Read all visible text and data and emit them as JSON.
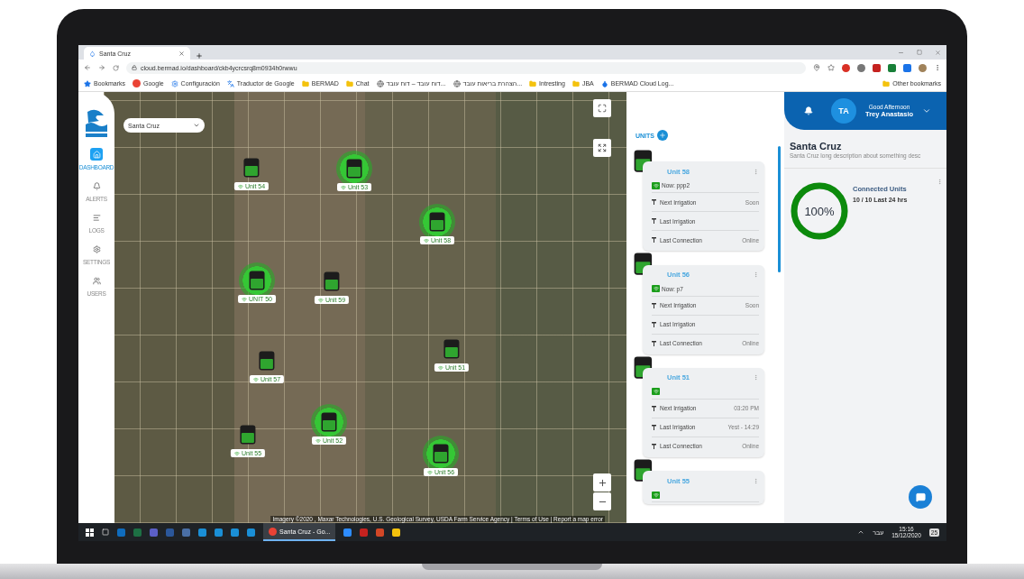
{
  "browser": {
    "tab_title": "Santa Cruz",
    "url": "cloud.bermad.io/dashboard/ckb4ycrcsrq8m0934h0rwwu",
    "bookmarks": [
      {
        "label": "Bookmarks",
        "kind": "star"
      },
      {
        "label": "Google",
        "kind": "google"
      },
      {
        "label": "Configuración",
        "kind": "gear"
      },
      {
        "label": "Traductor de Google",
        "kind": "translate"
      },
      {
        "label": "BERMAD",
        "kind": "folder"
      },
      {
        "label": "Chat",
        "kind": "folder"
      },
      {
        "label": "דוח עובד – דוח עובד...",
        "kind": "globe"
      },
      {
        "label": "הצהרת בריאות עובד...",
        "kind": "globe"
      },
      {
        "label": "Intresting",
        "kind": "folder"
      },
      {
        "label": "JBA",
        "kind": "folder"
      },
      {
        "label": "BERMAD Cloud Log...",
        "kind": "logo"
      }
    ],
    "other_bookmarks": "Other bookmarks"
  },
  "nav": {
    "items": [
      {
        "label": "DASHBOARD",
        "kind": "home",
        "selected": true
      },
      {
        "label": "ALERTS",
        "kind": "bell",
        "selected": false
      },
      {
        "label": "LOGS",
        "kind": "lines",
        "selected": false
      },
      {
        "label": "SETTINGS",
        "kind": "gear",
        "selected": false
      },
      {
        "label": "USERS",
        "kind": "users",
        "selected": false
      }
    ]
  },
  "map": {
    "site_select": "Santa Cruz",
    "markers": [
      {
        "label": "Unit 54",
        "highlighted": false
      },
      {
        "label": "Unit 53",
        "highlighted": true
      },
      {
        "label": "Unit 58",
        "highlighted": true
      },
      {
        "label": "UNIT 50",
        "highlighted": true
      },
      {
        "label": "Unit 59",
        "highlighted": false
      },
      {
        "label": "Unit 51",
        "highlighted": false
      },
      {
        "label": "Unit 57",
        "highlighted": false
      },
      {
        "label": "Unit 52",
        "highlighted": true
      },
      {
        "label": "Unit 55",
        "highlighted": false
      },
      {
        "label": "Unit 56",
        "highlighted": true
      }
    ],
    "attribution": "Imagery ©2020 , Maxar Technologies, U.S. Geological Survey, USDA Farm Service Agency | Terms of Use | Report a map error"
  },
  "units": {
    "title": "UNITS",
    "cards": [
      {
        "name": "Unit 58",
        "status": "Now: ppp2",
        "rows": [
          {
            "label": "Next Irrigation",
            "value": "Soon"
          },
          {
            "label": "Last Irrigation"
          },
          {
            "label": "Last Connection",
            "value": "Online"
          }
        ]
      },
      {
        "name": "Unit 56",
        "status": "Now: p7",
        "rows": [
          {
            "label": "Next Irrigation",
            "value": "Soon"
          },
          {
            "label": "Last Irrigation"
          },
          {
            "label": "Last Connection",
            "value": "Online"
          }
        ]
      },
      {
        "name": "Unit 51",
        "rows": [
          {
            "label": "Next Irrigation",
            "value": "03:20 PM"
          },
          {
            "label": "Last Irrigation",
            "value": "Yest - 14:29"
          },
          {
            "label": "Last Connection",
            "value": "Online"
          }
        ]
      },
      {
        "name": "Unit 55"
      }
    ]
  },
  "header": {
    "initials": "TA",
    "greeting": "Good Afternoon",
    "user": "Trey Anastasio"
  },
  "site": {
    "title": "Santa Cruz",
    "description": "Santa Cruz long description about something desc"
  },
  "connected": {
    "percent": "100%",
    "level": 1,
    "title": "Connected Units",
    "detail": "10 / 10 Last 24 hrs"
  },
  "taskbar": {
    "window": "Santa Cruz - Go...",
    "language": "עבר",
    "time": "15:16",
    "date": "15/12/2020",
    "notifications": "25"
  }
}
